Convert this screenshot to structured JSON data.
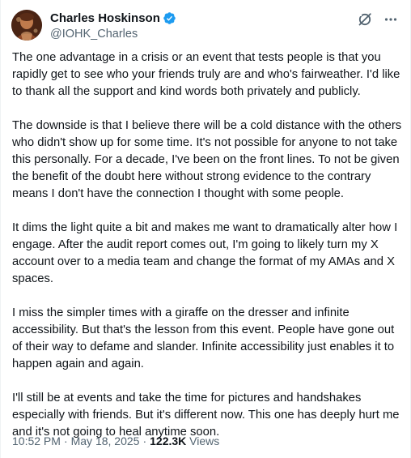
{
  "author": {
    "display_name": "Charles Hoskinson",
    "handle": "@IOHK_Charles",
    "verified": true
  },
  "icons": {
    "verified": "verified-badge-icon",
    "grok": "grok-icon",
    "more": "more-options-icon",
    "verified_color": "#1d9bf0"
  },
  "body": {
    "paragraphs": [
      "The one advantage in a crisis or an event that tests people is that you rapidly get to see who your friends truly are and who's fairweather. I'd like to thank all the support and kind words both privately and publicly.",
      "The downside is that I believe there will be a cold distance with the others who didn't show up for some time. It's not possible for anyone to not take this personally. For a decade, I've been on the front lines. To not be given the benefit of the doubt here without strong evidence to the contrary means I don't have the connection I thought with some people.",
      "It dims the light quite a bit and makes me want to dramatically alter how I engage. After the audit report comes out, I'm going to likely turn my X account over to a media team and change the format of my AMAs and X spaces.",
      "I miss the simpler times with a giraffe on the dresser and infinite accessibility. But that's the lesson from this event. People have gone out of their way to defame and slander. Infinite accessibility just enables it to happen again and again.",
      "I'll still be at events and take the time for pictures and handshakes especially with friends. But it's different now. This one has deeply hurt me and it's not going to heal anytime soon."
    ]
  },
  "meta": {
    "time": "10:52 PM",
    "separator": "·",
    "date": "May 18, 2025",
    "views_count": "122.3K",
    "views_label": "Views"
  }
}
